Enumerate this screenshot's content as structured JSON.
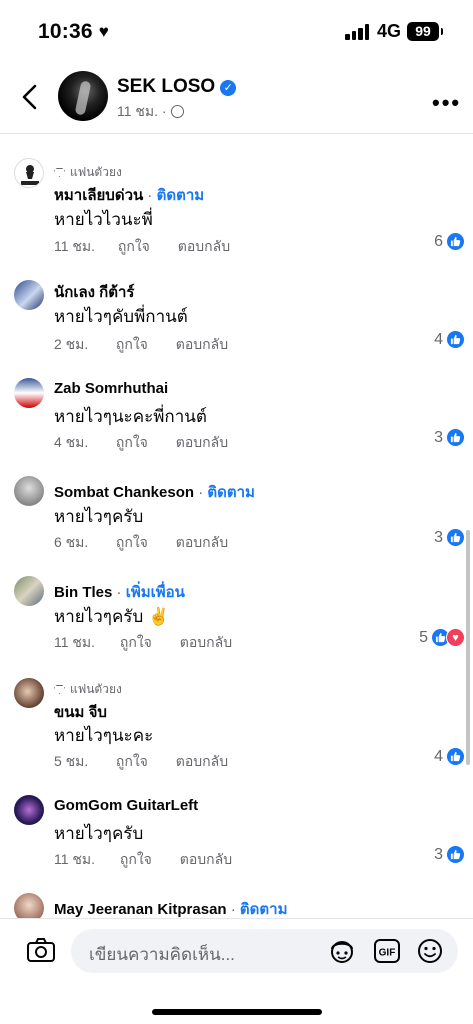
{
  "status": {
    "time": "10:36",
    "network": "4G",
    "battery": "99"
  },
  "header": {
    "name": "SEK LOSO",
    "meta": "11 ชม. ·"
  },
  "comments": [
    {
      "badge": "แฟนตัวยง",
      "name": "หมาเลียบด่วน",
      "follow": "ติดตาม",
      "text": "หายไวไวนะพี่",
      "time": "11 ชม.",
      "like": "ถูกใจ",
      "reply": "ตอบกลับ",
      "count": "6"
    },
    {
      "name": "นักเลง กีต้าร์",
      "text": "หายไวๆคับพี่กานต์",
      "time": "2 ชม.",
      "like": "ถูกใจ",
      "reply": "ตอบกลับ",
      "count": "4"
    },
    {
      "name": "Zab Somrhuthai",
      "text": "หายไวๆนะคะพี่กานต์",
      "time": "4 ชม.",
      "like": "ถูกใจ",
      "reply": "ตอบกลับ",
      "count": "3"
    },
    {
      "name": "Sombat Chankeson",
      "follow": "ติดตาม",
      "text": "หายไวๆครับ",
      "time": "6 ชม.",
      "like": "ถูกใจ",
      "reply": "ตอบกลับ",
      "count": "3"
    },
    {
      "name": "Bin Tles",
      "follow": "เพิ่มเพื่อน",
      "text": "หายไวๆครับ ✌️",
      "time": "11 ชม.",
      "like": "ถูกใจ",
      "reply": "ตอบกลับ",
      "count": "5"
    },
    {
      "badge": "แฟนตัวยง",
      "name": "ขนม จีบ",
      "text": "หายไวๆนะคะ",
      "time": "5 ชม.",
      "like": "ถูกใจ",
      "reply": "ตอบกลับ",
      "count": "4"
    },
    {
      "name": "GomGom GuitarLeft",
      "text": "หายไวๆครับ",
      "time": "11 ชม.",
      "like": "ถูกใจ",
      "reply": "ตอบกลับ",
      "count": "3"
    },
    {
      "name": "May Jeeranan Kitprasan",
      "follow": "ติดตาม"
    }
  ],
  "composer": {
    "placeholder": "เขียนความคิดเห็น...",
    "gif": "GIF"
  },
  "colors": {
    "accent": "#1877f2",
    "love": "#f33e58",
    "muted": "#65676b"
  }
}
